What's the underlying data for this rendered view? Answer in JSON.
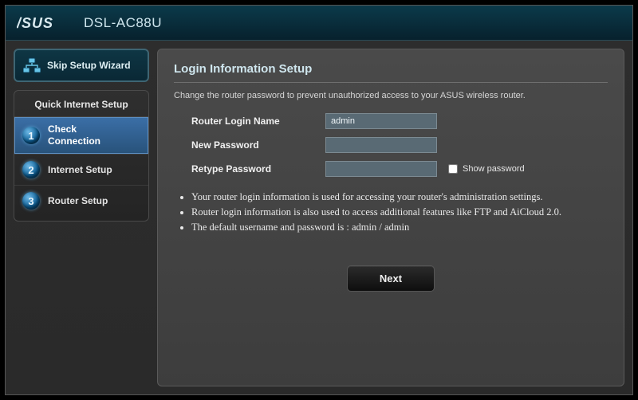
{
  "header": {
    "brand": "ASUS",
    "product": "DSL-AC88U"
  },
  "sidebar": {
    "skip_label": "Skip Setup Wizard",
    "qis_title": "Quick Internet Setup",
    "steps": [
      {
        "num": "1",
        "label": "Check\nConnection",
        "active": true
      },
      {
        "num": "2",
        "label": "Internet Setup",
        "active": false
      },
      {
        "num": "3",
        "label": "Router Setup",
        "active": false
      }
    ]
  },
  "main": {
    "title": "Login Information Setup",
    "intro": "Change the router password to prevent unauthorized access to your ASUS wireless router.",
    "fields": {
      "login_name_label": "Router Login Name",
      "login_name_value": "admin",
      "new_password_label": "New Password",
      "new_password_value": "",
      "retype_password_label": "Retype Password",
      "retype_password_value": "",
      "show_password_label": "Show password"
    },
    "bullets": [
      "Your router login information is used for accessing your router's administration settings.",
      "Router login information is also used to access additional features like FTP and AiCloud 2.0.",
      "The default username and password is : admin / admin"
    ],
    "next_label": "Next"
  }
}
